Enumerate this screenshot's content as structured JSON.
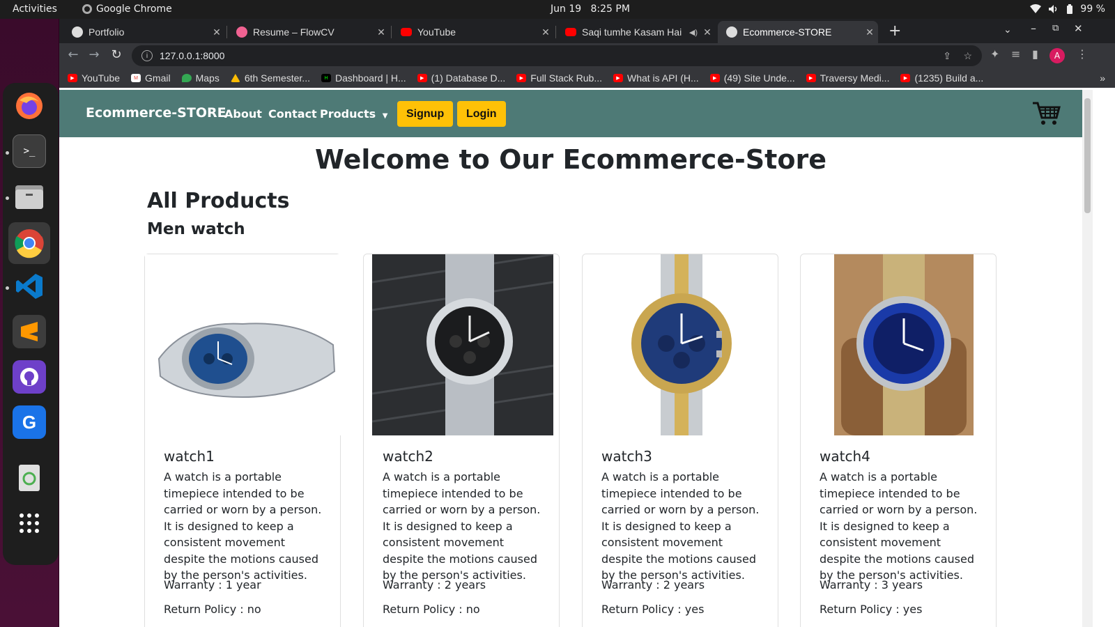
{
  "system": {
    "activities": "Activities",
    "app_name": "Google Chrome",
    "date": "Jun 19",
    "time": "8:25 PM",
    "battery": "99 %"
  },
  "tabs": [
    {
      "title": "Portfolio",
      "active": false
    },
    {
      "title": "Resume – FlowCV",
      "active": false
    },
    {
      "title": "YouTube",
      "active": false
    },
    {
      "title": "Saqi tumhe Kasam Hai",
      "active": false
    },
    {
      "title": "Ecommerce-STORE",
      "active": true
    }
  ],
  "address": {
    "url": "127.0.0.1:8000"
  },
  "bookmarks": [
    "YouTube",
    "Gmail",
    "Maps",
    "6th Semester...",
    "Dashboard | H...",
    "(1) Database D...",
    "Full Stack Rub...",
    "What is API (H...",
    "(49) Site Unde...",
    "Traversy Medi...",
    "(1235) Build a..."
  ],
  "avatar_letter": "A",
  "navbar": {
    "brand": "Ecommerce-STORE",
    "about": "About",
    "contact": "Contact",
    "products": "Products",
    "signup": "Signup",
    "login": "Login"
  },
  "page": {
    "welcome": "Welcome to Our Ecommerce-Store",
    "section": "All Products",
    "category": "Men watch"
  },
  "products": [
    {
      "name": "watch1",
      "description": "A watch is a portable timepiece intended to be carried or worn by a person. It is designed to keep a consistent movement despite the motions caused by the person's activities.",
      "warranty": "Warranty : 1 year",
      "return_policy": "Return Policy : no"
    },
    {
      "name": "watch2",
      "description": "A watch is a portable timepiece intended to be carried or worn by a person. It is designed to keep a consistent movement despite the motions caused by the person's activities.",
      "warranty": "Warranty : 2 years",
      "return_policy": "Return Policy : no"
    },
    {
      "name": "watch3",
      "description": "A watch is a portable timepiece intended to be carried or worn by a person. It is designed to keep a consistent movement despite the motions caused by the person's activities.",
      "warranty": "Warranty : 2 years",
      "return_policy": "Return Policy : yes"
    },
    {
      "name": "watch4",
      "description": "A watch is a portable timepiece intended to be carried or worn by a person. It is designed to keep a consistent movement despite the motions caused by the person's activities.",
      "warranty": "Warranty : 3 years",
      "return_policy": "Return Policy : yes"
    }
  ],
  "colors": {
    "navbar": "#4e7a76",
    "button": "#ffc107"
  }
}
